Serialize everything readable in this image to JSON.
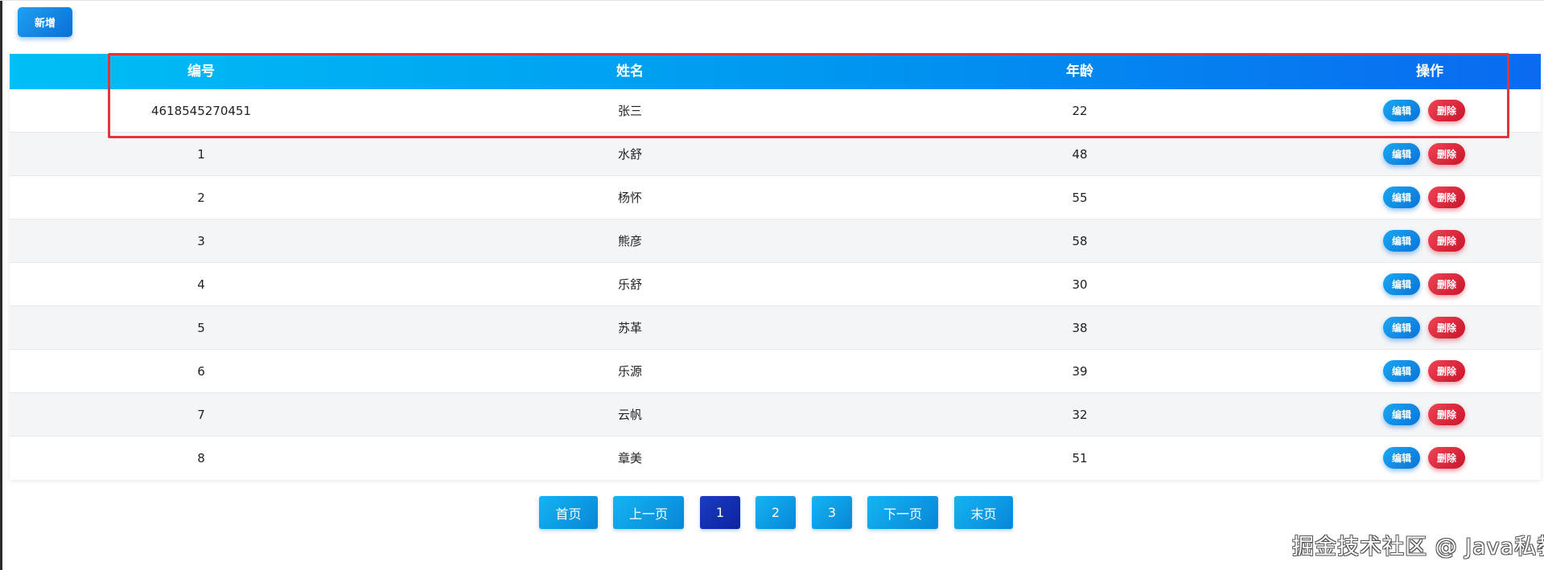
{
  "toolbar": {
    "add_label": "新增"
  },
  "table": {
    "headers": [
      "编号",
      "姓名",
      "年龄",
      "操作"
    ],
    "rows": [
      {
        "id": "4618545270451",
        "name": "张三",
        "age": "22"
      },
      {
        "id": "1",
        "name": "水舒",
        "age": "48"
      },
      {
        "id": "2",
        "name": "杨怀",
        "age": "55"
      },
      {
        "id": "3",
        "name": "熊彦",
        "age": "58"
      },
      {
        "id": "4",
        "name": "乐舒",
        "age": "30"
      },
      {
        "id": "5",
        "name": "苏革",
        "age": "38"
      },
      {
        "id": "6",
        "name": "乐源",
        "age": "39"
      },
      {
        "id": "7",
        "name": "云帆",
        "age": "32"
      },
      {
        "id": "8",
        "name": "章美",
        "age": "51"
      }
    ],
    "edit_label": "编辑",
    "delete_label": "删除"
  },
  "pagination": {
    "first": "首页",
    "prev": "上一页",
    "pages": [
      "1",
      "2",
      "3"
    ],
    "current": "1",
    "next": "下一页",
    "last": "末页"
  },
  "watermark": "掘金技术社区 @ Java私教",
  "colors": {
    "header_gradient_start": "#00bff5",
    "header_gradient_end": "#0a6af0",
    "edit_button": "#0a73d8",
    "delete_button": "#c8142a",
    "active_page": "#0d22a0",
    "highlight_box": "#e0353f"
  }
}
